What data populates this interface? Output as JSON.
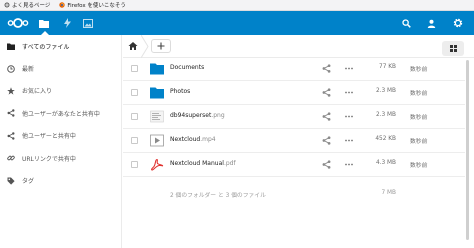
{
  "bookmarks": [
    {
      "label": "よく見るページ",
      "icon": "gear-icon"
    },
    {
      "label": "Firefox を使いこなそう",
      "icon": "firefox-icon"
    }
  ],
  "header": {
    "logo": "nextcloud-logo",
    "apps": [
      {
        "name": "files",
        "icon": "folder-icon"
      },
      {
        "name": "activity",
        "icon": "bolt-icon"
      },
      {
        "name": "gallery",
        "icon": "image-icon"
      }
    ],
    "accent": "#0082c9"
  },
  "sidebar": {
    "items": [
      {
        "label": "すべてのファイル",
        "icon": "folder-icon",
        "active": true
      },
      {
        "label": "最新",
        "icon": "clock-icon"
      },
      {
        "label": "お気に入り",
        "icon": "star-icon"
      },
      {
        "label": "他ユーザーがあなたと共有中",
        "icon": "share-icon"
      },
      {
        "label": "他ユーザーと共有中",
        "icon": "share-icon"
      },
      {
        "label": "URLリンクで共有中",
        "icon": "link-icon"
      },
      {
        "label": "タグ",
        "icon": "tag-icon"
      }
    ]
  },
  "files": [
    {
      "name": "Documents",
      "ext": "",
      "type": "folder",
      "size": "77 KB",
      "modified": "数秒前"
    },
    {
      "name": "Photos",
      "ext": "",
      "type": "folder",
      "size": "2.3 MB",
      "modified": "数秒前"
    },
    {
      "name": "db94superset",
      "ext": ".png",
      "type": "image",
      "size": "2.3 MB",
      "modified": "数秒前"
    },
    {
      "name": "Nextcloud",
      "ext": ".mp4",
      "type": "video",
      "size": "452 KB",
      "modified": "数秒前"
    },
    {
      "name": "Nextcloud Manual",
      "ext": ".pdf",
      "type": "pdf",
      "size": "4.3 MB",
      "modified": "数秒前"
    }
  ],
  "summary": {
    "text": "2 個のフォルダー と 3 個のファイル",
    "size": "7 MB"
  }
}
